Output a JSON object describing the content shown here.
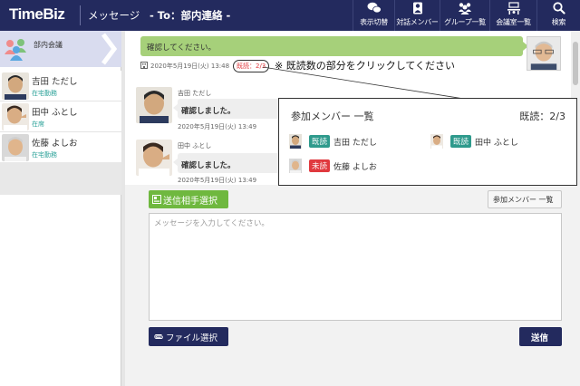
{
  "header": {
    "logo": "TimeBiz",
    "title": "メッセージ",
    "subtitle": "- To：部内連絡 -",
    "nav": [
      {
        "label": "表示切替",
        "icon": "chat-bubbles-icon"
      },
      {
        "label": "対話メンバー",
        "icon": "person-icon"
      },
      {
        "label": "グループ一覧",
        "icon": "group-icon"
      },
      {
        "label": "会議室一覧",
        "icon": "meeting-room-icon"
      },
      {
        "label": "検索",
        "icon": "search-icon"
      }
    ]
  },
  "sidebar": {
    "room": {
      "name": "部内会議"
    },
    "members": [
      {
        "name": "吉田 ただし",
        "status": "在宅勤務"
      },
      {
        "name": "田中 ふとし",
        "status": "在席"
      },
      {
        "name": "佐藤 よしお",
        "status": "在宅勤務"
      }
    ]
  },
  "chat": {
    "my_message": {
      "text": "確認してください。",
      "time": "2020年5月19日(火) 13:48",
      "read_badge": "既読：2/3"
    },
    "hint": "※ 既読数の部分をクリックしてください",
    "messages": [
      {
        "sender": "吉田 ただし",
        "text": "確認しました。",
        "time": "2020年5月19日(火) 13:49"
      },
      {
        "sender": "田中 ふとし",
        "text": "確認しました。",
        "time": "2020年5月19日(火) 13:49"
      }
    ]
  },
  "popup": {
    "title": "参加メンバー 一覧",
    "count": "既読：2/3",
    "members": [
      {
        "badge": "既読",
        "badge_color": "#2e9a8c",
        "name": "吉田 ただし"
      },
      {
        "badge": "既読",
        "badge_color": "#2e9a8c",
        "name": "田中 ふとし"
      },
      {
        "badge": "未読",
        "badge_color": "#e0393e",
        "name": "佐藤 よしお"
      }
    ]
  },
  "compose": {
    "send_to_label": "送信相手選択",
    "members_button_label": "参加メンバー 一覧",
    "placeholder": "メッセージを入力してください。",
    "file_button_label": "ファイル選択",
    "send_button_label": "送信"
  },
  "colors": {
    "header_bg": "#232a5e",
    "my_bubble": "#a6d07a",
    "read_badge": "#2e9a8c",
    "unread_badge": "#e0393e",
    "accent_green": "#6fb83f"
  }
}
